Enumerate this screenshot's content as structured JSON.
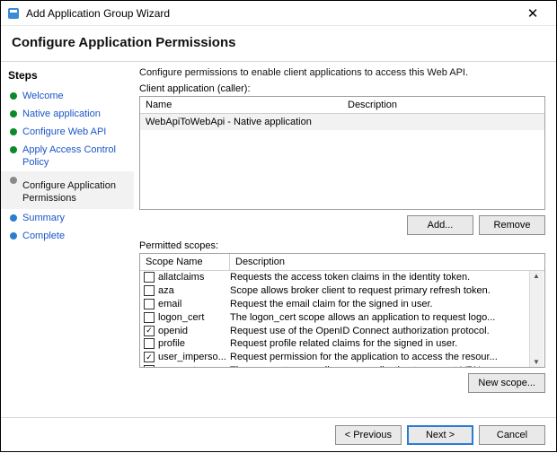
{
  "window": {
    "title": "Add Application Group Wizard",
    "close": "✕"
  },
  "heading": "Configure Application Permissions",
  "sidebar": {
    "title": "Steps",
    "items": [
      {
        "label": "Welcome",
        "state": "done"
      },
      {
        "label": "Native application",
        "state": "done"
      },
      {
        "label": "Configure Web API",
        "state": "done"
      },
      {
        "label": "Apply Access Control Policy",
        "state": "done"
      },
      {
        "label": "Configure Application Permissions",
        "state": "current"
      },
      {
        "label": "Summary",
        "state": "todo"
      },
      {
        "label": "Complete",
        "state": "todo"
      }
    ]
  },
  "main": {
    "intro": "Configure permissions to enable client applications to access this Web API.",
    "client_label": "Client application (caller):",
    "client_cols": {
      "name": "Name",
      "desc": "Description"
    },
    "client_row": "WebApiToWebApi - Native application",
    "add": "Add...",
    "remove": "Remove",
    "scopes_label": "Permitted scopes:",
    "scope_cols": {
      "name": "Scope Name",
      "desc": "Description"
    },
    "scopes": [
      {
        "name": "allatclaims",
        "desc": "Requests the access token claims in the identity token.",
        "checked": false
      },
      {
        "name": "aza",
        "desc": "Scope allows broker client to request primary refresh token.",
        "checked": false
      },
      {
        "name": "email",
        "desc": "Request the email claim for the signed in user.",
        "checked": false
      },
      {
        "name": "logon_cert",
        "desc": "The logon_cert scope allows an application to request logo...",
        "checked": false
      },
      {
        "name": "openid",
        "desc": "Request use of the OpenID Connect authorization protocol.",
        "checked": true
      },
      {
        "name": "profile",
        "desc": "Request profile related claims for the signed in user.",
        "checked": false
      },
      {
        "name": "user_imperso...",
        "desc": "Request permission for the application to access the resour...",
        "checked": true
      },
      {
        "name": "vpn_cert",
        "desc": "The vpn_cert scope allows an application to request VPN ...",
        "checked": false
      }
    ],
    "new_scope": "New scope..."
  },
  "buttons": {
    "prev": "< Previous",
    "next": "Next >",
    "cancel": "Cancel"
  }
}
